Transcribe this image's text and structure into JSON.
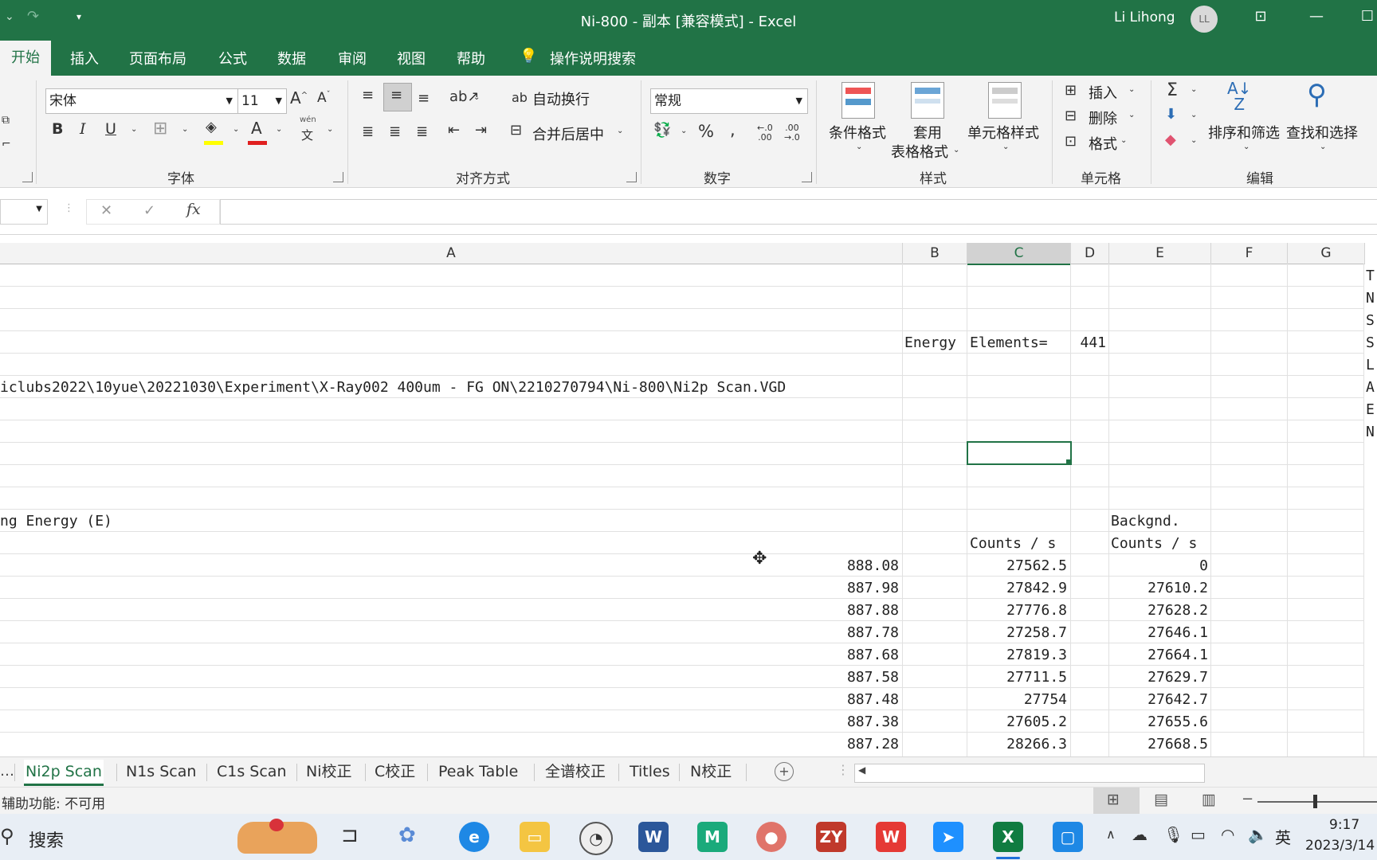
{
  "window": {
    "title": "Ni-800 - 副本  [兼容模式]  -  Excel",
    "user": "Li Lihong",
    "avatar": "LL"
  },
  "ribbon_tabs": [
    "开始",
    "插入",
    "页面布局",
    "公式",
    "数据",
    "审阅",
    "视图",
    "帮助",
    "操作说明搜索"
  ],
  "ribbon": {
    "font_name": "宋体",
    "font_size": "11",
    "grow_font": "A",
    "shrink_font": "A",
    "bold": "B",
    "italic": "I",
    "underline": "U",
    "phonetic": "wén",
    "wrap_text": "自动换行",
    "merge_center": "合并后居中",
    "number_format": "常规",
    "conditional_format": "条件格式",
    "format_as_table_1": "套用",
    "format_as_table_2": "表格格式",
    "cell_styles": "单元格样式",
    "insert": "插入",
    "delete": "删除",
    "format": "格式",
    "sort_filter": "排序和筛选",
    "find_select": "查找和选择",
    "groups": {
      "font": "字体",
      "alignment": "对齐方式",
      "number": "数字",
      "styles": "样式",
      "cells": "单元格",
      "editing": "编辑"
    }
  },
  "formula_bar": {
    "fx": "fx",
    "cancel": "✕",
    "enter": "✓"
  },
  "columns": [
    "A",
    "B",
    "C",
    "D",
    "E",
    "F",
    "G"
  ],
  "cells": {
    "energy_label": "Energy",
    "elements_label": "Elements=",
    "elements_value": "441",
    "path": "iclubs2022\\10yue\\20221030\\Experiment\\X-Ray002 400um - FG  ON\\2210270794\\Ni-800\\Ni2p Scan.VGD",
    "binding_energy": "ng Energy (E)",
    "backgnd": "Backgnd.",
    "counts_c": "Counts / s",
    "counts_e": "Counts / s",
    "right_edge": [
      "T",
      "N",
      "S",
      "S",
      "L",
      "A",
      "E",
      "N"
    ]
  },
  "data_rows": [
    {
      "a": "888.08",
      "c": "27562.5",
      "e": "0"
    },
    {
      "a": "887.98",
      "c": "27842.9",
      "e": "27610.2"
    },
    {
      "a": "887.88",
      "c": "27776.8",
      "e": "27628.2"
    },
    {
      "a": "887.78",
      "c": "27258.7",
      "e": "27646.1"
    },
    {
      "a": "887.68",
      "c": "27819.3",
      "e": "27664.1"
    },
    {
      "a": "887.58",
      "c": "27711.5",
      "e": "27629.7"
    },
    {
      "a": "887.48",
      "c": "27754",
      "e": "27642.7"
    },
    {
      "a": "887.38",
      "c": "27605.2",
      "e": "27655.6"
    },
    {
      "a": "887.28",
      "c": "28266.3",
      "e": "27668.5"
    }
  ],
  "sheet_tabs": [
    "Ni2p Scan",
    "N1s Scan",
    "C1s Scan",
    "Ni校正",
    "C校正",
    "Peak Table",
    "全谱校正",
    "Titles",
    "N校正"
  ],
  "status_text": "辅助功能: 不可用",
  "taskbar": {
    "search": "搜索",
    "time": "9:17",
    "date": "2023/3/14",
    "ime": "英"
  }
}
